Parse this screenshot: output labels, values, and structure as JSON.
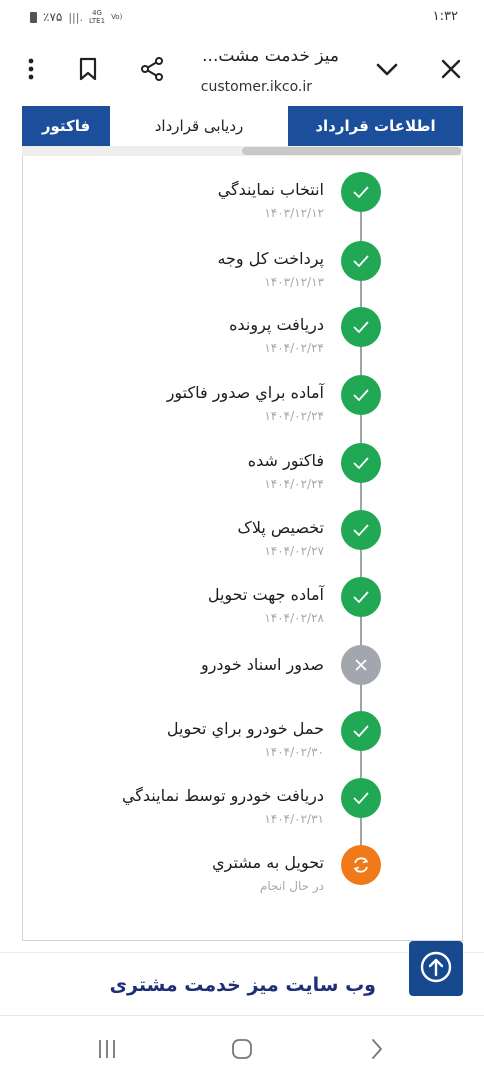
{
  "status": {
    "battery": "٪۷۵",
    "network_top": "4G",
    "network_bottom": "LTE1",
    "volte": "Vo)",
    "time": "۱:۳۲"
  },
  "browser": {
    "title": "میز خدمت مشت...",
    "url": "customer.ikco.ir"
  },
  "tabs": [
    {
      "label": "اطلاعات قرارداد",
      "active": true
    },
    {
      "label": "ردیابی قرارداد",
      "active": false
    },
    {
      "label": "فاکتور",
      "active": true
    }
  ],
  "steps": [
    {
      "title": "انتخاب نمايندگي",
      "date": "۱۴۰۳/۱۲/۱۲",
      "status": "done"
    },
    {
      "title": "پرداخت كل وجه",
      "date": "۱۴۰۳/۱۲/۱۳",
      "status": "done"
    },
    {
      "title": "دريافت پرونده",
      "date": "۱۴۰۴/۰۲/۲۴",
      "status": "done"
    },
    {
      "title": "آماده براي صدور فاكتور",
      "date": "۱۴۰۴/۰۲/۲۴",
      "status": "done"
    },
    {
      "title": "فاكتور شده",
      "date": "۱۴۰۴/۰۲/۲۴",
      "status": "done"
    },
    {
      "title": "تخصيص پلاک",
      "date": "۱۴۰۴/۰۲/۲۷",
      "status": "done"
    },
    {
      "title": "آماده جهت تحويل",
      "date": "۱۴۰۴/۰۲/۲۸",
      "status": "done"
    },
    {
      "title": "صدور اسناد خودرو",
      "date": "",
      "status": "skipped"
    },
    {
      "title": "حمل خودرو براي تحويل",
      "date": "۱۴۰۴/۰۲/۳۰",
      "status": "done"
    },
    {
      "title": "دريافت خودرو توسط نمايندگي",
      "date": "۱۴۰۴/۰۲/۳۱",
      "status": "done"
    },
    {
      "title": "تحويل به مشتري",
      "date": "در حال انجام",
      "status": "in-progress"
    }
  ],
  "footer": {
    "link": "وب سایت میز خدمت مشتری"
  },
  "colors": {
    "brand": "#1b4e9b",
    "done": "#21a854",
    "skipped": "#a2a6ad",
    "in_progress": "#f07a1a",
    "footer_text": "#1e2f78"
  },
  "icons": [
    "close-icon",
    "chevron-down-icon",
    "share-icon",
    "bookmark-icon",
    "more-vert-icon",
    "check-icon",
    "x-icon",
    "refresh-icon",
    "arrow-up-icon",
    "recents-icon",
    "home-icon",
    "back-icon"
  ]
}
